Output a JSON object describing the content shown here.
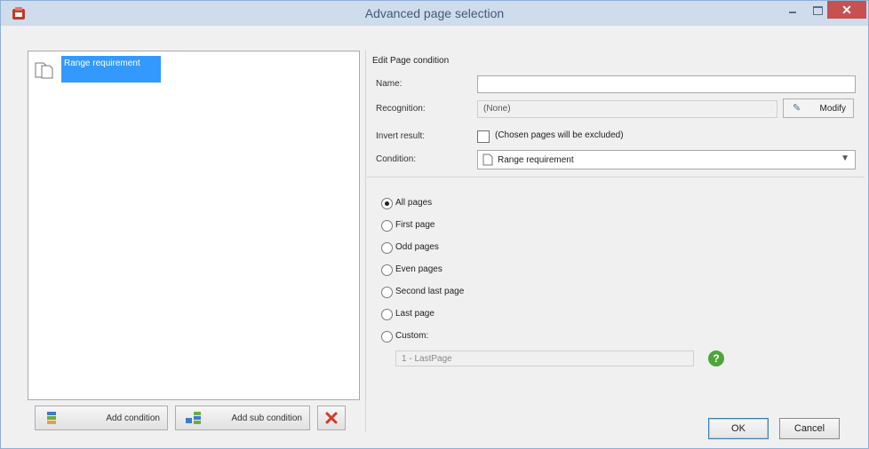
{
  "window": {
    "title": "Advanced page selection"
  },
  "colors": {
    "selection": "#3399ff",
    "close_button": "#c75050",
    "help": "#4fa43a"
  },
  "tree": {
    "items": [
      {
        "label": "Range requirement",
        "icon": "page-icon"
      }
    ]
  },
  "left_buttons": {
    "add_condition": "Add condition",
    "add_sub_condition": "Add sub condition",
    "delete_icon": "delete-x-icon"
  },
  "form": {
    "group_label": "Edit Page condition",
    "name_label": "Name:",
    "name_value": "",
    "recognition_label": "Recognition:",
    "recognition_value": "(None)",
    "modify_label": "Modify",
    "invert_label": "Invert result:",
    "invert_text": "(Chosen pages will be excluded)",
    "invert_checked": false,
    "condition_label": "Condition:",
    "condition_value": "Range requirement"
  },
  "radios": [
    {
      "label": "All pages",
      "checked": true
    },
    {
      "label": "First page",
      "checked": false
    },
    {
      "label": "Odd pages",
      "checked": false
    },
    {
      "label": "Even pages",
      "checked": false
    },
    {
      "label": "Second last page",
      "checked": false
    },
    {
      "label": "Last page",
      "checked": false
    },
    {
      "label": "Custom:",
      "checked": false
    }
  ],
  "custom_value": "1 - LastPage",
  "dialog_buttons": {
    "ok": "OK",
    "cancel": "Cancel"
  }
}
